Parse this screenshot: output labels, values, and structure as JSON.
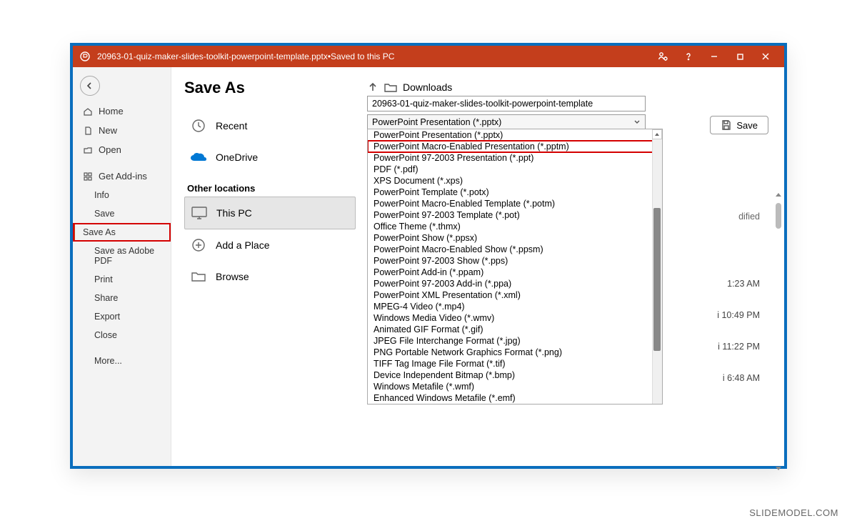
{
  "titlebar": {
    "filename": "20963-01-quiz-maker-slides-toolkit-powerpoint-template.pptx",
    "separator": " • ",
    "saved_status": "Saved to this PC"
  },
  "sidebar": {
    "home": "Home",
    "new": "New",
    "open": "Open",
    "get_addins": "Get Add-ins",
    "info": "Info",
    "save": "Save",
    "save_as": "Save As",
    "save_as_pdf": "Save as Adobe PDF",
    "print": "Print",
    "share": "Share",
    "export": "Export",
    "close": "Close",
    "more": "More..."
  },
  "locations": {
    "heading": "Save As",
    "recent": "Recent",
    "onedrive": "OneDrive",
    "other_locations": "Other locations",
    "this_pc": "This PC",
    "add_place": "Add a Place",
    "browse": "Browse"
  },
  "main": {
    "path_folder": "Downloads",
    "filename_value": "20963-01-quiz-maker-slides-toolkit-powerpoint-template",
    "selected_type": "PowerPoint Presentation (*.pptx)",
    "save_label": "Save",
    "date_modified_header": "dified",
    "times": [
      "1:23 AM",
      "i 10:49 PM",
      "i 11:22 PM",
      "i 6:48 AM"
    ]
  },
  "file_types": [
    "PowerPoint Presentation (*.pptx)",
    "PowerPoint Macro-Enabled Presentation (*.pptm)",
    "PowerPoint 97-2003 Presentation (*.ppt)",
    "PDF (*.pdf)",
    "XPS Document (*.xps)",
    "PowerPoint Template (*.potx)",
    "PowerPoint Macro-Enabled Template (*.potm)",
    "PowerPoint 97-2003 Template (*.pot)",
    "Office Theme (*.thmx)",
    "PowerPoint Show (*.ppsx)",
    "PowerPoint Macro-Enabled Show (*.ppsm)",
    "PowerPoint 97-2003 Show (*.pps)",
    "PowerPoint Add-in (*.ppam)",
    "PowerPoint 97-2003 Add-in (*.ppa)",
    "PowerPoint XML Presentation (*.xml)",
    "MPEG-4 Video (*.mp4)",
    "Windows Media Video (*.wmv)",
    "Animated GIF Format (*.gif)",
    "JPEG File Interchange Format (*.jpg)",
    "PNG Portable Network Graphics Format (*.png)",
    "TIFF Tag Image File Format (*.tif)",
    "Device Independent Bitmap (*.bmp)",
    "Windows Metafile (*.wmf)",
    "Enhanced Windows Metafile (*.emf)"
  ],
  "highlighted_type_index": 1,
  "watermark": "SLIDEMODEL.COM"
}
